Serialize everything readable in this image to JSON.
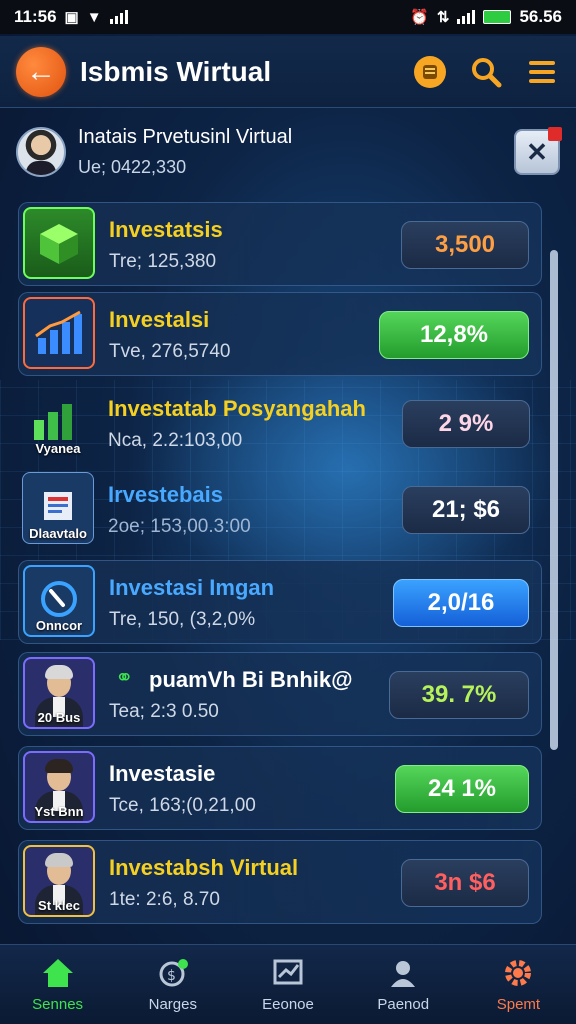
{
  "status_bar": {
    "time": "11:56",
    "battery_text": "56.56"
  },
  "header": {
    "title": "Isbmis Wirtual"
  },
  "profile": {
    "name": "Inatais Prvetusinl Virtual",
    "subtitle": "Ue; 0422,330"
  },
  "items": [
    {
      "title": "Investatsis",
      "subtitle": "Tre; 125,380",
      "value": "3,500",
      "thumb_caption": "",
      "title_color": "#f5d020",
      "value_color": "#ff9f43"
    },
    {
      "title": "Investalsi",
      "subtitle": "Tve, 276,5740",
      "value": "12,8%",
      "thumb_caption": "",
      "title_color": "#f5d020",
      "value_color": "#ffffff"
    },
    {
      "title": "Investatab Posyangahah",
      "subtitle": "Nca, 2.2:103,00",
      "value": "2 9%",
      "thumb_caption": "Vyanea",
      "title_color": "#f5d020",
      "value_color": "#ffd6e6"
    },
    {
      "title": "Irvestebais",
      "subtitle": "2oe; 153,00.3:00",
      "value": "21; $6",
      "thumb_caption": "Dlaavtalo",
      "title_color": "#49a9ff",
      "value_color": "#ffffff"
    },
    {
      "title": "Investasi Imgan",
      "subtitle": "Tre, 150, (3,2,0%",
      "value": "2,0/16",
      "thumb_caption": "Onncor",
      "title_color": "#49a9ff",
      "value_color": "#ffffff"
    },
    {
      "title": "puamVh Bi Bnhik@",
      "subtitle": "Tea; 2:3 0.50",
      "value": "39. 7%",
      "thumb_caption": "20 Bus",
      "title_color": "#ffffff",
      "value_color": "#b6f25a"
    },
    {
      "title": "Investasie",
      "subtitle": "Tce, 163;(0,21,00",
      "value": "24 1%",
      "thumb_caption": "Yst Bnn",
      "title_color": "#ffffff",
      "value_color": "#ffffff"
    },
    {
      "title": "Investabsh Virtual",
      "subtitle": "1te: 2:6, 8.70",
      "value": "3n $6",
      "thumb_caption": "St klec",
      "title_color": "#f5d020",
      "value_color": "#ff5f5f"
    }
  ],
  "nav": [
    {
      "label": "Sennes",
      "icon": "home-icon"
    },
    {
      "label": "Narges",
      "icon": "refresh-money-icon"
    },
    {
      "label": "Eeonoe",
      "icon": "chart-board-icon"
    },
    {
      "label": "Paenod",
      "icon": "profile-pin-icon"
    },
    {
      "label": "Spemt",
      "icon": "gear-icon"
    }
  ],
  "colors": {
    "accent_orange": "#e25310",
    "accent_green": "#3ee34d",
    "accent_blue": "#1560d8",
    "background": "#0d2446"
  }
}
